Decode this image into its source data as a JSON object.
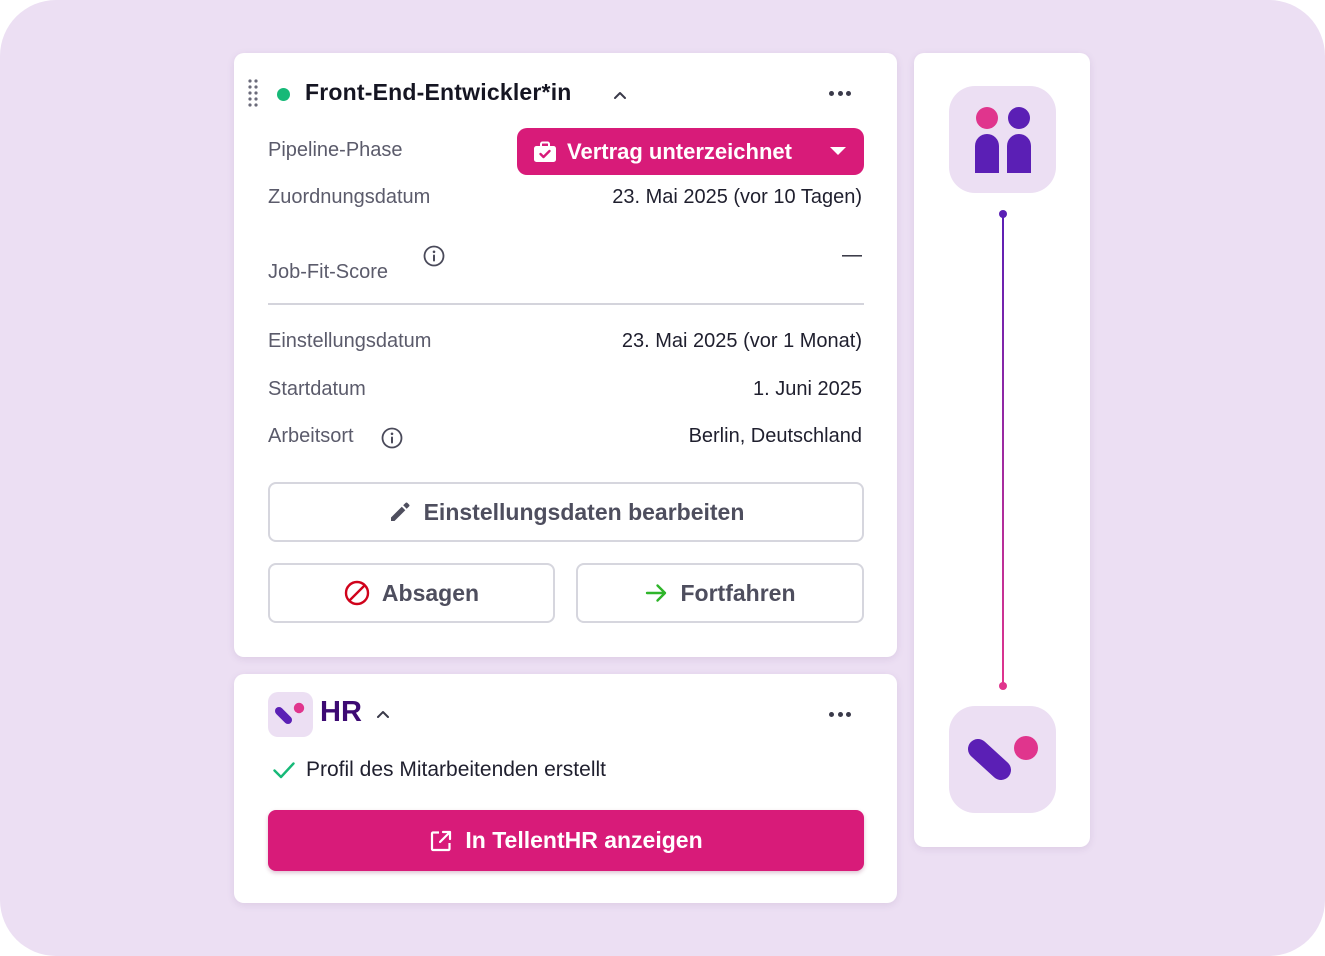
{
  "pipeline_card": {
    "job_title": "Front-End-Entwickler*in",
    "status_color": "#17b978",
    "stage_label": "Pipeline-Phase",
    "stage_value": "Vertrag unterzeichnet",
    "assignment_label": "Zuordnungsdatum",
    "assignment_value": "23. Mai 2025 (vor 10 Tagen)",
    "jobfit_label": "Job-Fit-Score",
    "jobfit_value": "—",
    "hire_date_label": "Einstellungsdatum",
    "hire_date_value": "23. Mai 2025 (vor 1 Monat)",
    "start_date_label": "Startdatum",
    "start_date_value": "1. Juni 2025",
    "location_label": "Arbeitsort",
    "location_value": "Berlin, Deutschland",
    "edit_button": "Einstellungsdaten bearbeiten",
    "reject_button": "Absagen",
    "proceed_button": "Fortfahren"
  },
  "hr_card": {
    "title": "HR",
    "status_text": "Profil des Mitarbeitenden erstellt",
    "open_button": "In TellentHR anzeigen"
  },
  "icons": {
    "drag": "drag-handle-icon",
    "more": "more-horizontal-icon",
    "caret": "chevron-up-icon",
    "briefcase": "briefcase-check-icon",
    "info": "info-icon",
    "edit": "pencil-icon",
    "reject": "prohibited-icon",
    "proceed": "arrow-right-icon",
    "check": "check-icon",
    "external": "external-link-icon"
  },
  "colors": {
    "background": "#ecdff3",
    "accent": "#d81b79",
    "brand_purple": "#5b1fb5",
    "brand_pink": "#e0358d",
    "success": "#17b978",
    "danger": "#d0021b",
    "proceed_green": "#2fb52a"
  }
}
